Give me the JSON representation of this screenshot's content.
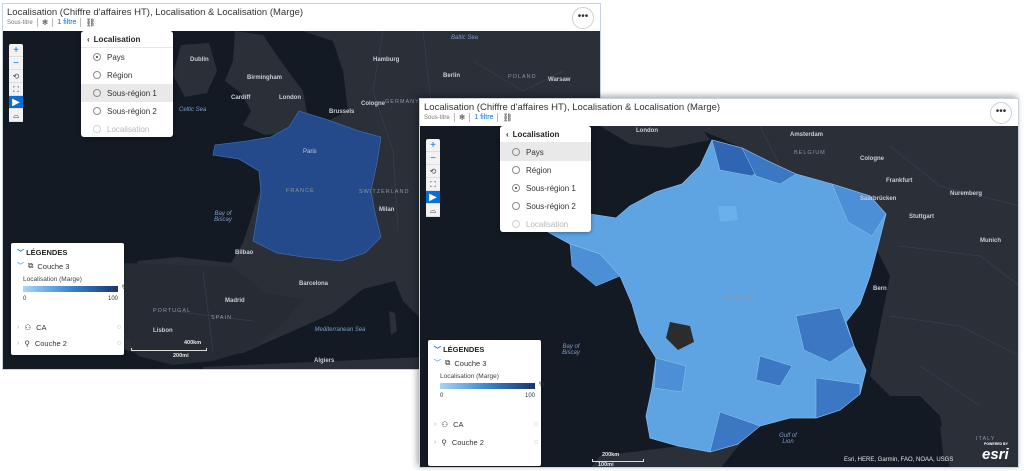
{
  "header": {
    "title": "Localisation (Chiffre d'affaires HT), Localisation & Localisation (Marge)",
    "subtitle": "Sous-titre",
    "filter_label": "1 filtre",
    "more_label": "•••"
  },
  "toolbar": {
    "zoom_in": "+",
    "zoom_out": "−"
  },
  "menu1": {
    "title": "Localisation",
    "items": [
      "Pays",
      "Région",
      "Sous-région 1",
      "Sous-région 2",
      "Localisation"
    ],
    "selected": "Pays"
  },
  "menu2": {
    "title": "Localisation",
    "items": [
      "Pays",
      "Région",
      "Sous-région 1",
      "Sous-région 2",
      "Localisation"
    ],
    "selected": "Sous-région 1"
  },
  "legend": {
    "title": "LÉGENDES",
    "layer": "Couche 3",
    "measure": "Localisation (Marge)",
    "unit": "%",
    "min": "0",
    "max": "100",
    "rows": [
      "CA",
      "Couche 2"
    ]
  },
  "map1": {
    "labels": {
      "baltic": "Baltic Sea",
      "dublin": "Dublin",
      "birmingham": "Birmingham",
      "hamburg": "Hamburg",
      "berlin": "Berlin",
      "poland": "POLAND",
      "warsaw": "Warsaw",
      "cardiff": "Cardiff",
      "london": "London",
      "celtic": "Celtic Sea",
      "brussels": "Brussels",
      "cologne": "Cologne",
      "germany": "GERMANY",
      "paris": "Paris",
      "france": "FRANCE",
      "biscay": "Bay of Biscay",
      "switzerland": "SWITZERLAND",
      "milan": "Milan",
      "bilbao": "Bilbao",
      "barcelona": "Barcelona",
      "madrid": "Madrid",
      "portugal": "PORTUGAL",
      "spain": "SPAIN",
      "lisbon": "Lisbon",
      "mediterranean": "Mediterranean Sea",
      "algiers": "Algiers",
      "scale_km": "400km",
      "scale_mi": "200mi"
    }
  },
  "map2": {
    "labels": {
      "london": "London",
      "amsterdam": "Amsterdam",
      "belgium": "BELGIUM",
      "cologne": "Cologne",
      "frankfurt": "Frankfurt",
      "nuremberg": "Nuremberg",
      "saarbrucken": "Saarbrücken",
      "stuttgart": "Stuttgart",
      "munich": "Munich",
      "france": "FRANCE",
      "bern": "Bern",
      "biscay": "Bay of Biscay",
      "gulf": "Gulf of Lion",
      "italy": "ITALY",
      "scale_km": "200km",
      "scale_mi": "100mi"
    },
    "attribution": "Esri, HERE, Garmin, FAO, NOAA, USGS",
    "powered_by": "POWERED BY",
    "esri": "esri"
  },
  "colors": {
    "map_bg": "#141a24",
    "land": "#2a2f38",
    "france_country": "#244a8c",
    "france_light": "#5ea4e3",
    "france_mid": "#4c8fd6",
    "france_dark": "#2f65b3",
    "accent": "#0a6ed1"
  }
}
